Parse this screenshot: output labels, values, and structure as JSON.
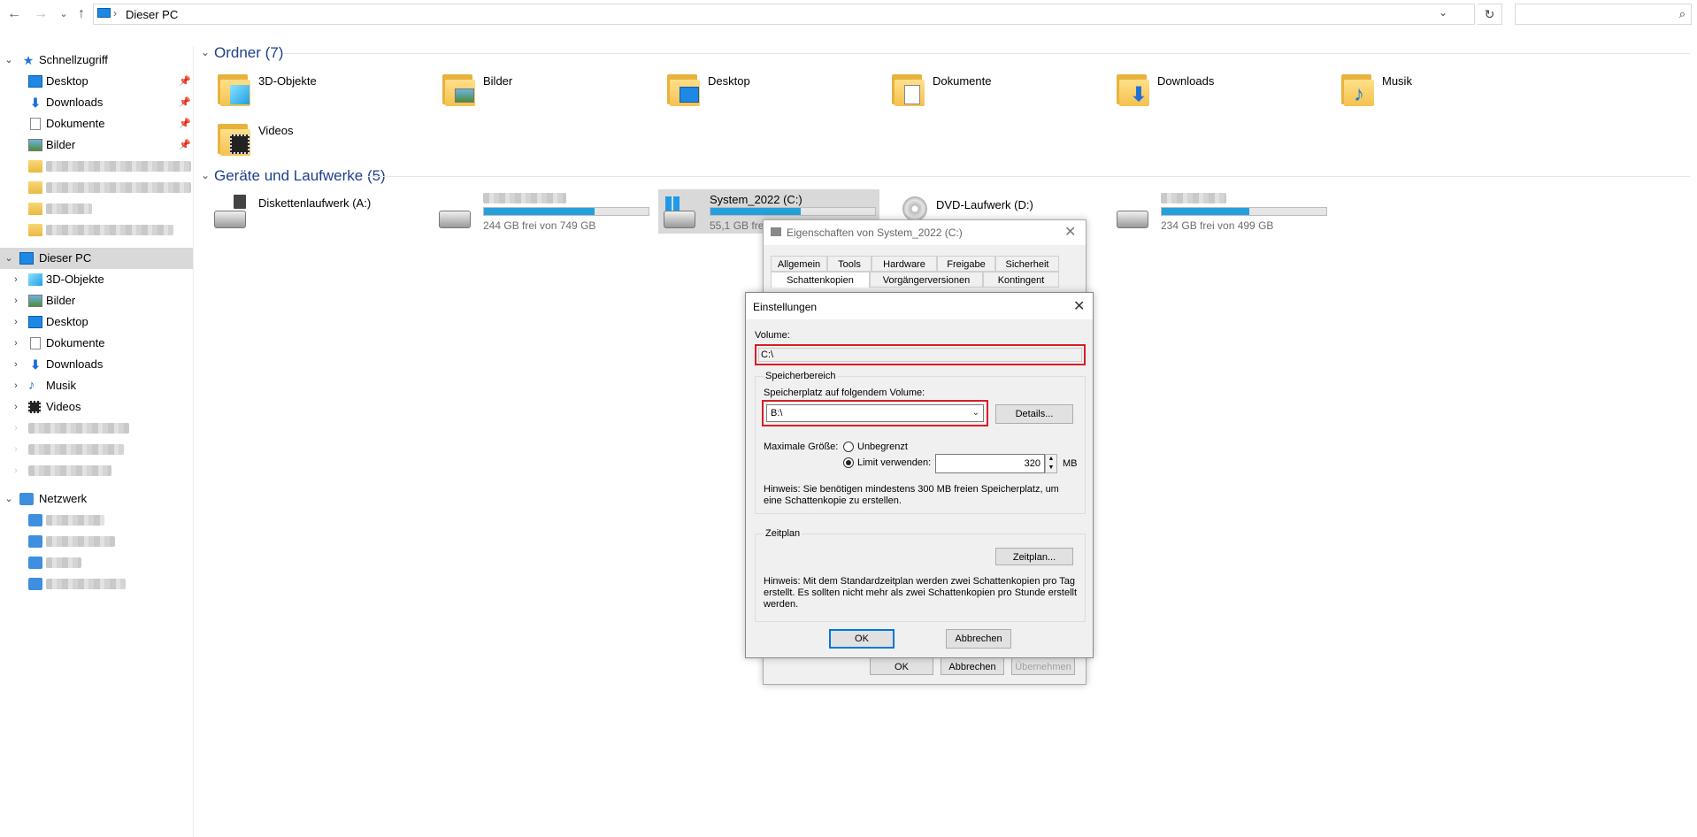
{
  "addressbar": {
    "path": "Dieser PC",
    "separator": "›",
    "dropdown": "⌄",
    "refresh": "↻",
    "search_placeholder": ""
  },
  "nav": {
    "back": "←",
    "forward": "→",
    "recent": "⌄",
    "up": "↑"
  },
  "sidebar": {
    "quick_access": {
      "label": "Schnellzugriff",
      "items": [
        "Desktop",
        "Downloads",
        "Dokumente",
        "Bilder"
      ]
    },
    "this_pc": {
      "label": "Dieser PC",
      "items": [
        "3D-Objekte",
        "Bilder",
        "Desktop",
        "Dokumente",
        "Downloads",
        "Musik",
        "Videos"
      ]
    },
    "network": {
      "label": "Netzwerk"
    }
  },
  "folders": {
    "header": "Ordner (7)",
    "items": [
      "3D-Objekte",
      "Bilder",
      "Desktop",
      "Dokumente",
      "Downloads",
      "Musik",
      "Videos"
    ]
  },
  "drives": {
    "header": "Geräte und Laufwerke (5)",
    "items": [
      {
        "name": "Diskettenlaufwerk (A:)",
        "sub": "",
        "fill": 0
      },
      {
        "name": "",
        "sub": "244 GB frei von 749 GB",
        "fill": 0.67
      },
      {
        "name": "System_2022 (C:)",
        "sub": "55,1 GB frei",
        "fill": 0.55
      },
      {
        "name": "DVD-Laufwerk (D:)",
        "sub": "",
        "fill": 0
      },
      {
        "name": "",
        "sub": "234 GB frei von 499 GB",
        "fill": 0.53
      }
    ]
  },
  "properties_dialog": {
    "title": "Eigenschaften von System_2022 (C:)",
    "tabs_row1": [
      "Allgemein",
      "Tools",
      "Hardware",
      "Freigabe",
      "Sicherheit"
    ],
    "tabs_row2": [
      "Schattenkopien",
      "Vorgängerversionen",
      "Kontingent"
    ],
    "ok": "OK",
    "cancel": "Abbrechen",
    "apply": "Übernehmen"
  },
  "settings_dialog": {
    "title": "Einstellungen",
    "volume_label": "Volume:",
    "volume_value": "C:\\",
    "storage_group": "Speicherbereich",
    "storage_label": "Speicherplatz auf folgendem Volume:",
    "storage_value": "B:\\",
    "details_button": "Details...",
    "max_size_label": "Maximale Größe:",
    "unlimited": "Unbegrenzt",
    "use_limit": "Limit verwenden:",
    "limit_value": "320",
    "limit_unit": "MB",
    "hint1": "Hinweis: Sie benötigen mindestens 300 MB freien Speicherplatz, um eine Schattenkopie zu erstellen.",
    "schedule_group": "Zeitplan",
    "schedule_button": "Zeitplan...",
    "hint2": "Hinweis: Mit dem Standardzeitplan werden zwei Schattenkopien pro Tag erstellt. Es sollten nicht mehr als zwei Schattenkopien pro Stunde erstellt werden.",
    "ok": "OK",
    "cancel": "Abbrechen"
  }
}
